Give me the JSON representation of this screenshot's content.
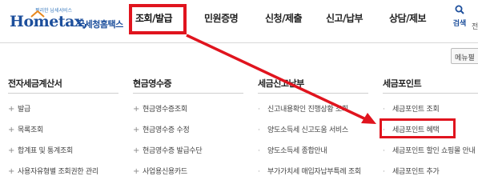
{
  "logo": {
    "slogan": "편리한 납세서비스",
    "brand": "Hometax,",
    "org": "국세청홈택스"
  },
  "gnb": [
    {
      "label": "조회/발급",
      "active": true
    },
    {
      "label": "민원증명",
      "active": false
    },
    {
      "label": "신청/제출",
      "active": false
    },
    {
      "label": "신고/납부",
      "active": false
    },
    {
      "label": "상담/제보",
      "active": false
    }
  ],
  "search": {
    "label": "검색",
    "icon": "search-icon"
  },
  "cut_text": "전",
  "menu_button": "메뉴펼",
  "columns": [
    {
      "title": "전자세금계산서",
      "items": [
        "발급",
        "목록조회",
        "합계표 및 통계조회",
        "사용자유형별 조회권한 관리"
      ]
    },
    {
      "title": "현금영수증",
      "items": [
        "현금영수증조회",
        "현금영수증 수정",
        "현금영수증 발급수단",
        "사업용신용카드"
      ]
    },
    {
      "title": "세금신고납부",
      "items": [
        "신고내용확인 진행상황 조회",
        "양도소득세 신고도움 서비스",
        "양도소득세 종합안내",
        "부가가치세 매입자납부특례 조회"
      ]
    },
    {
      "title": "세금포인트",
      "items": [
        "세금포인트 조회",
        "세금포인트 혜택",
        "세금포인트 할인 쇼핑몰 안내",
        "세금포인트 추가"
      ]
    }
  ],
  "colors": {
    "highlight": "#e0141e",
    "brand": "#1d4f9c"
  }
}
